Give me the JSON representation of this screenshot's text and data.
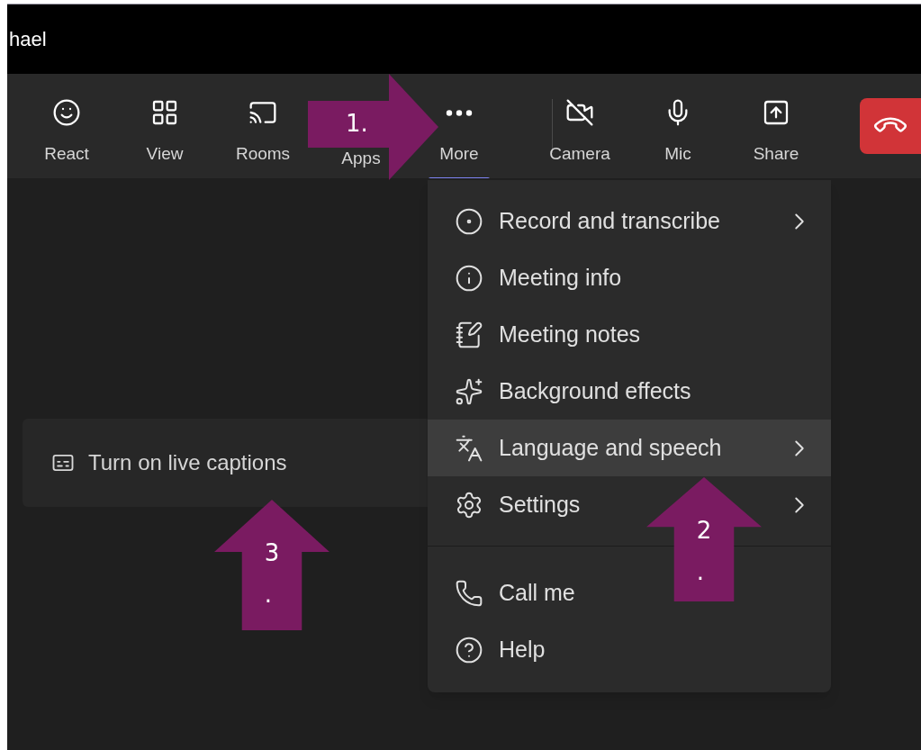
{
  "title_bar": {
    "title": "hael"
  },
  "toolbar": {
    "items": [
      {
        "label": "React",
        "selected": false
      },
      {
        "label": "View",
        "selected": false
      },
      {
        "label": "Rooms",
        "selected": false
      },
      {
        "label": "Apps",
        "selected": false
      },
      {
        "label": "More",
        "selected": true
      },
      {
        "label": "Camera",
        "selected": false
      },
      {
        "label": "Mic",
        "selected": false
      },
      {
        "label": "Share",
        "selected": false
      }
    ]
  },
  "captions_panel": {
    "label": "Turn on live captions"
  },
  "menu": {
    "sections": [
      {
        "items": [
          {
            "label": "Record and transcribe",
            "submenu": true,
            "selected": false
          },
          {
            "label": "Meeting info",
            "submenu": false,
            "selected": false
          },
          {
            "label": "Meeting notes",
            "submenu": false,
            "selected": false
          },
          {
            "label": "Background effects",
            "submenu": false,
            "selected": false
          },
          {
            "label": "Language and speech",
            "submenu": true,
            "selected": true
          },
          {
            "label": "Settings",
            "submenu": true,
            "selected": false
          }
        ]
      },
      {
        "items": [
          {
            "label": "Call me",
            "submenu": false,
            "selected": false
          },
          {
            "label": "Help",
            "submenu": false,
            "selected": false
          }
        ]
      }
    ]
  },
  "annotations": [
    {
      "kind": "right",
      "lines": [
        "1."
      ]
    },
    {
      "kind": "up",
      "lines": [
        "2",
        "."
      ]
    },
    {
      "kind": "up",
      "lines": [
        "3",
        "."
      ]
    }
  ]
}
